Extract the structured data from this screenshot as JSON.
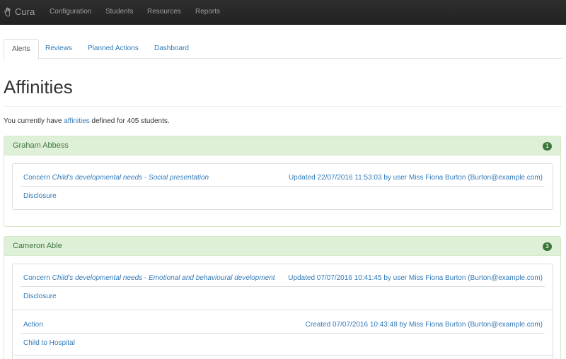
{
  "navbar": {
    "brand": "Cura",
    "items": [
      "Configuration",
      "Students",
      "Resources",
      "Reports"
    ]
  },
  "tabs": [
    "Alerts",
    "Reviews",
    "Planned Actions",
    "Dashboard"
  ],
  "page": {
    "title": "Affinities",
    "intro_before": "You currently have",
    "intro_link": "affinities",
    "intro_after": "defined for 405 students."
  },
  "students": [
    {
      "name": "Graham Abbess",
      "count": "1",
      "entries": [
        {
          "type": "Concern",
          "category": "Child's developmental needs - Social presentation",
          "meta": "Updated 22/07/2016 11:53:03 by user Miss Fiona Burton (Burton@example.com)",
          "detail": "Disclosure"
        }
      ]
    },
    {
      "name": "Cameron Able",
      "count": "3",
      "entries": [
        {
          "type": "Concern",
          "category": "Child's developmental needs - Emotional and behavioural development",
          "meta": "Updated 07/07/2016 10:41:45 by user Miss Fiona Burton (Burton@example.com)",
          "detail": "Disclosure"
        },
        {
          "type": "Action",
          "category": "",
          "meta": "Created 07/07/2016 10:43:48 by Miss Fiona Burton (Burton@example.com)",
          "detail": "Child to Hospital"
        }
      ]
    }
  ],
  "colors": {
    "navbar": "#222222",
    "link": "#337ab7",
    "panel_heading": "#dff0d8",
    "panel_text": "#3c763d"
  }
}
